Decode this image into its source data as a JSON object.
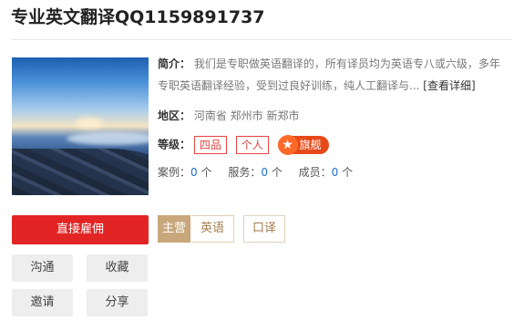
{
  "header": {
    "title": "专业英文翻译QQ1159891737"
  },
  "profile": {
    "intro_label": "简介：",
    "intro_line1": "我们是专职做英语翻译的，所有译员均为英语专八或六级，多年",
    "intro_line2": "专职英语翻译经验，受到过良好训练，纯人工翻译与...",
    "intro_more": "[查看详细]",
    "area_label": "地区：",
    "area_value": "河南省 郑州市 新郑市",
    "level_label": "等级：",
    "level_tags": [
      "四品",
      "个人"
    ],
    "flagship_label": "旗舰",
    "stats": {
      "cases_label": "案例：",
      "cases_value": "0",
      "cases_unit": "个",
      "service_label": "服务：",
      "service_value": "0",
      "service_unit": "个",
      "members_label": "成员：",
      "members_value": "0",
      "members_unit": "个"
    }
  },
  "actions": {
    "hire": "直接雇佣",
    "contact": "沟通",
    "favorite": "收藏",
    "invite": "邀请",
    "share": "分享"
  },
  "services": {
    "main_label": "主营",
    "items": [
      "英语",
      "口译"
    ]
  },
  "colors": {
    "accent_red": "#e32424",
    "link_blue": "#1f6fcf",
    "service_gold": "#c8a77c",
    "flag_orange": "#e64a19"
  }
}
